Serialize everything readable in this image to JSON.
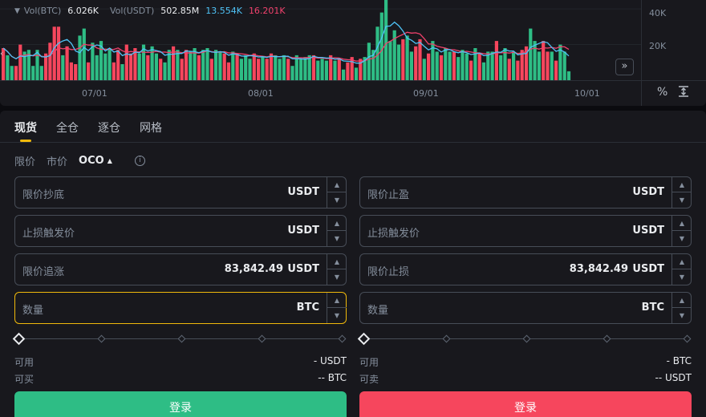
{
  "chart": {
    "legend": {
      "vol_btc_label": "Vol(BTC)",
      "vol_btc_value": "6.026K",
      "vol_usdt_label": "Vol(USDT)",
      "vol_usdt_value": "502.85M",
      "ma1_value": "13.554K",
      "ma2_value": "16.201K"
    },
    "y_ticks": [
      "40K",
      "20K"
    ],
    "x_dates": [
      "07/01",
      "08/01",
      "09/01",
      "10/01"
    ],
    "colors": {
      "up": "#2ebd85",
      "down": "#f6465d",
      "ma1": "#4fc3f7",
      "ma2": "#f0416c"
    },
    "icons": {
      "collapse": "chevron-down-icon",
      "expand": "double-chevron-right-icon",
      "percent": "percent-icon",
      "fit": "fit-height-icon"
    }
  },
  "chart_data": {
    "type": "bar",
    "title": "",
    "ylim": [
      0,
      45000
    ],
    "y_ticks": [
      20000,
      40000
    ],
    "bars": [
      [
        18000,
        "d"
      ],
      [
        14000,
        "u"
      ],
      [
        8000,
        "u"
      ],
      [
        8000,
        "d"
      ],
      [
        20000,
        "d"
      ],
      [
        16000,
        "u"
      ],
      [
        17000,
        "u"
      ],
      [
        8000,
        "u"
      ],
      [
        17000,
        "u"
      ],
      [
        8000,
        "u"
      ],
      [
        15000,
        "d"
      ],
      [
        21000,
        "d"
      ],
      [
        30000,
        "d"
      ],
      [
        30000,
        "d"
      ],
      [
        14000,
        "u"
      ],
      [
        19000,
        "d"
      ],
      [
        10000,
        "d"
      ],
      [
        9000,
        "d"
      ],
      [
        25000,
        "u"
      ],
      [
        29000,
        "u"
      ],
      [
        10000,
        "d"
      ],
      [
        21000,
        "u"
      ],
      [
        14000,
        "u"
      ],
      [
        22000,
        "u"
      ],
      [
        15000,
        "u"
      ],
      [
        18000,
        "u"
      ],
      [
        10000,
        "d"
      ],
      [
        17000,
        "d"
      ],
      [
        9000,
        "u"
      ],
      [
        20000,
        "d"
      ],
      [
        15000,
        "d"
      ],
      [
        18000,
        "d"
      ],
      [
        15000,
        "u"
      ],
      [
        20000,
        "u"
      ],
      [
        14000,
        "d"
      ],
      [
        19000,
        "u"
      ],
      [
        15000,
        "u"
      ],
      [
        12000,
        "d"
      ],
      [
        10000,
        "u"
      ],
      [
        17000,
        "u"
      ],
      [
        19000,
        "d"
      ],
      [
        17000,
        "u"
      ],
      [
        12000,
        "d"
      ],
      [
        17000,
        "d"
      ],
      [
        16000,
        "u"
      ],
      [
        18000,
        "u"
      ],
      [
        14000,
        "d"
      ],
      [
        17000,
        "u"
      ],
      [
        18000,
        "u"
      ],
      [
        12000,
        "d"
      ],
      [
        17000,
        "u"
      ],
      [
        16000,
        "u"
      ],
      [
        15000,
        "d"
      ],
      [
        10000,
        "d"
      ],
      [
        16000,
        "u"
      ],
      [
        15000,
        "d"
      ],
      [
        12000,
        "u"
      ],
      [
        14000,
        "u"
      ],
      [
        12000,
        "u"
      ],
      [
        15000,
        "d"
      ],
      [
        12000,
        "d"
      ],
      [
        13000,
        "u"
      ],
      [
        12000,
        "d"
      ],
      [
        15000,
        "d"
      ],
      [
        14000,
        "u"
      ],
      [
        12000,
        "u"
      ],
      [
        14000,
        "u"
      ],
      [
        12000,
        "d"
      ],
      [
        8000,
        "u"
      ],
      [
        14000,
        "u"
      ],
      [
        12000,
        "u"
      ],
      [
        13000,
        "u"
      ],
      [
        14000,
        "u"
      ],
      [
        14000,
        "d"
      ],
      [
        11000,
        "u"
      ],
      [
        12000,
        "u"
      ],
      [
        11000,
        "u"
      ],
      [
        14000,
        "d"
      ],
      [
        11000,
        "u"
      ],
      [
        12000,
        "d"
      ],
      [
        6000,
        "u"
      ],
      [
        10000,
        "d"
      ],
      [
        13000,
        "d"
      ],
      [
        7000,
        "u"
      ],
      [
        12000,
        "d"
      ],
      [
        13000,
        "u"
      ],
      [
        21000,
        "u"
      ],
      [
        17000,
        "u"
      ],
      [
        30000,
        "u"
      ],
      [
        38000,
        "u"
      ],
      [
        45000,
        "u"
      ],
      [
        22000,
        "u"
      ],
      [
        28000,
        "u"
      ],
      [
        20000,
        "u"
      ],
      [
        23000,
        "d"
      ],
      [
        25000,
        "u"
      ],
      [
        16000,
        "u"
      ],
      [
        19000,
        "d"
      ],
      [
        23000,
        "d"
      ],
      [
        12000,
        "u"
      ],
      [
        15000,
        "d"
      ],
      [
        22000,
        "u"
      ],
      [
        16000,
        "u"
      ],
      [
        14000,
        "d"
      ],
      [
        18000,
        "u"
      ],
      [
        16000,
        "u"
      ],
      [
        16000,
        "d"
      ],
      [
        13000,
        "u"
      ],
      [
        17000,
        "u"
      ],
      [
        15000,
        "u"
      ],
      [
        11000,
        "d"
      ],
      [
        18000,
        "u"
      ],
      [
        15000,
        "d"
      ],
      [
        10000,
        "u"
      ],
      [
        16000,
        "u"
      ],
      [
        16000,
        "u"
      ],
      [
        22000,
        "d"
      ],
      [
        14000,
        "u"
      ],
      [
        18000,
        "u"
      ],
      [
        12000,
        "d"
      ],
      [
        16000,
        "u"
      ],
      [
        11000,
        "d"
      ],
      [
        17000,
        "d"
      ],
      [
        19000,
        "d"
      ],
      [
        29000,
        "u"
      ],
      [
        22000,
        "u"
      ],
      [
        16000,
        "u"
      ],
      [
        22000,
        "d"
      ],
      [
        16000,
        "d"
      ],
      [
        16000,
        "u"
      ],
      [
        11000,
        "d"
      ],
      [
        20000,
        "u"
      ],
      [
        16000,
        "u"
      ],
      [
        5000,
        "u"
      ]
    ]
  },
  "trade": {
    "tabs": [
      "现货",
      "全仓",
      "逐仓",
      "网格"
    ],
    "order_types": {
      "limit": "限价",
      "market": "市价",
      "oco": "OCO"
    },
    "buy": {
      "f1_label": "限价抄底",
      "f1_unit": "USDT",
      "f2_label": "止损触发价",
      "f2_unit": "USDT",
      "f3_label": "限价追涨",
      "f3_value": "83,842.49",
      "f3_unit": "USDT",
      "f4_label": "数量",
      "f4_unit": "BTC",
      "avail_label": "可用",
      "avail_value": "- USDT",
      "max_label": "可买",
      "max_value": "-- BTC",
      "login": "登录"
    },
    "sell": {
      "f1_label": "限价止盈",
      "f1_unit": "USDT",
      "f2_label": "止损触发价",
      "f2_unit": "USDT",
      "f3_label": "限价止损",
      "f3_value": "83,842.49",
      "f3_unit": "USDT",
      "f4_label": "数量",
      "f4_unit": "BTC",
      "avail_label": "可用",
      "avail_value": "- BTC",
      "max_label": "可卖",
      "max_value": "-- USDT",
      "login": "登录"
    },
    "colors": {
      "buy": "#2ebd85",
      "sell": "#f6465d",
      "focus": "#f0b90b"
    }
  }
}
